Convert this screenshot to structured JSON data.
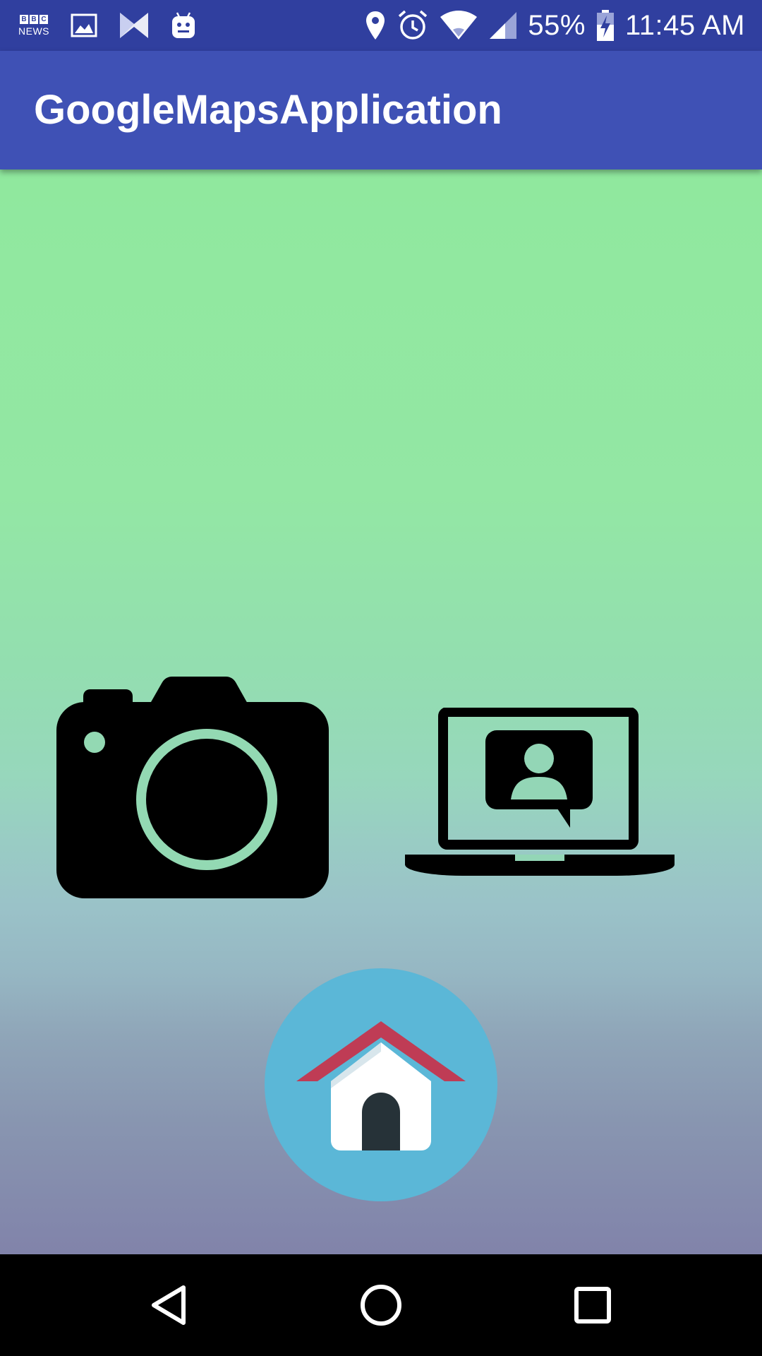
{
  "status_bar": {
    "bbc_letters": [
      "B",
      "B",
      "C"
    ],
    "bbc_news_label": "NEWS",
    "battery_percent": "55%",
    "time": "11:45 AM",
    "icons_left": [
      "bbc-news-icon",
      "image-icon",
      "messenger-icon",
      "android-icon"
    ],
    "icons_right": [
      "location-icon",
      "alarm-icon",
      "wifi-icon",
      "cell-signal-icon",
      "battery-charging-icon"
    ]
  },
  "app_bar": {
    "title": "GoogleMapsApplication"
  },
  "main": {
    "buttons": [
      "camera-icon",
      "laptop-chat-icon",
      "home-icon"
    ]
  },
  "nav_bar": {
    "buttons": [
      "back-icon",
      "home-circle-icon",
      "recents-icon"
    ]
  },
  "colors": {
    "status_bar": "#303F9F",
    "app_bar": "#3F51B5",
    "background_top": "#90E89E",
    "background_bottom": "#8183AA",
    "home_circle": "#5BB7D7",
    "roof": "#BF3C55",
    "door": "#263238"
  }
}
